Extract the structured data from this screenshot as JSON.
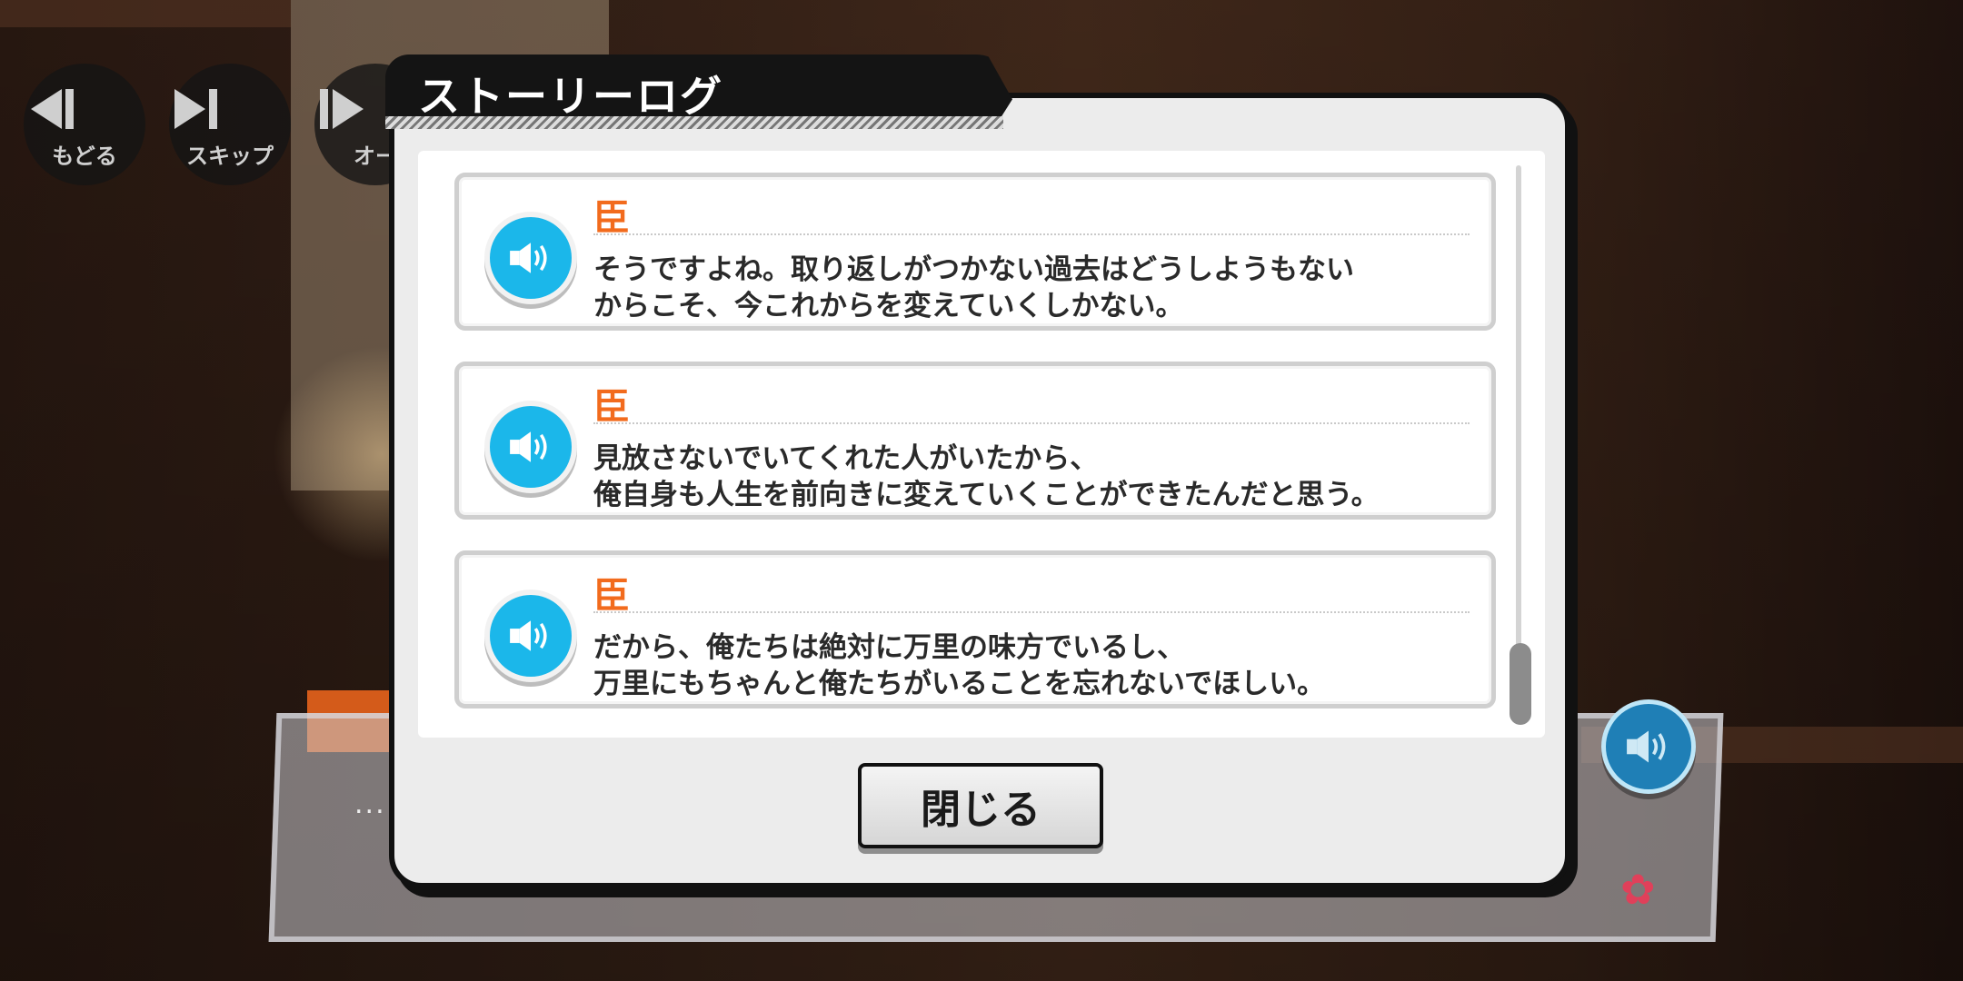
{
  "controls": {
    "back_label": "もどる",
    "skip_label": "スキップ",
    "auto_label": "オー"
  },
  "modal": {
    "title": "ストーリーログ",
    "close_label": "閉じる"
  },
  "log_entries": [
    {
      "speaker": "臣",
      "line1": "そうですよね。取り返しがつかない過去はどうしようもない",
      "line2": "からこそ、今これからを変えていくしかない。"
    },
    {
      "speaker": "臣",
      "line1": "見放さないでいてくれた人がいたから、",
      "line2": "俺自身も人生を前向きに変えていくことができたんだと思う。"
    },
    {
      "speaker": "臣",
      "line1": "だから、俺たちは絶対に万里の味方でいるし、",
      "line2": "万里にもちゃんと俺たちがいることを忘れないでほしい。"
    }
  ],
  "textbox": {
    "ellipsis": "..."
  },
  "colors": {
    "speaker": "#f26b1d",
    "voice_button": "#1bb7ea",
    "modal_bg": "#ececec"
  }
}
